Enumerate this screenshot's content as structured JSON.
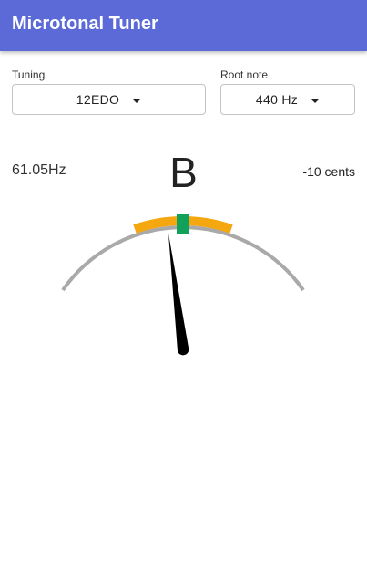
{
  "app": {
    "title": "Microtonal Tuner"
  },
  "tuning": {
    "label": "Tuning",
    "value": "12EDO"
  },
  "root": {
    "label": "Root note",
    "value": "440 Hz"
  },
  "readout": {
    "frequency": "61.05Hz",
    "note": "B",
    "cents": "-10 cents"
  },
  "colors": {
    "appbar": "#5b6ad6",
    "arc_track": "#a9a9a9",
    "arc_tolerance": "#f5a70f",
    "in_tune": "#12a15a",
    "needle": "#000000"
  },
  "icons": {
    "dropdown": "chevron-down-icon"
  }
}
